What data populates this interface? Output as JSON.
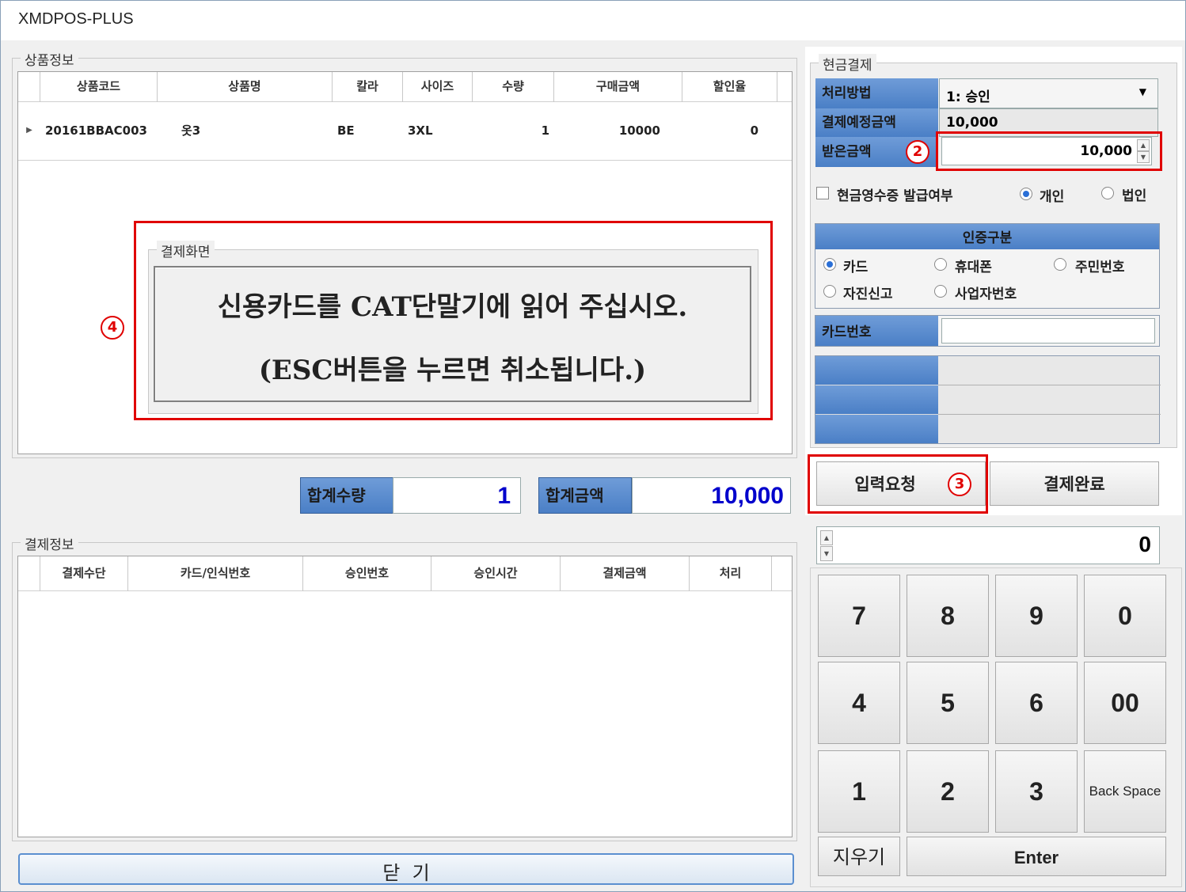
{
  "window": {
    "title": "XMDPOS-PLUS"
  },
  "product_group": {
    "legend": "상품정보",
    "columns": [
      "상품코드",
      "상품명",
      "칼라",
      "사이즈",
      "수량",
      "구매금액",
      "할인율"
    ],
    "rows": [
      {
        "code": "20161BBAC003",
        "name": "옷3",
        "color": "BE",
        "size": "3XL",
        "qty": "1",
        "amount": "10000",
        "discount": "0"
      }
    ]
  },
  "payment_screen": {
    "legend": "결제화면",
    "line1": "신용카드를 CAT단말기에 읽어 주십시오.",
    "line2": "(ESC버튼을 누르면 취소됩니다.)"
  },
  "totals": {
    "qty_label": "합계수량",
    "qty_value": "1",
    "amount_label": "합계금액",
    "amount_value": "10,000"
  },
  "payment_info": {
    "legend": "결제정보",
    "columns": [
      "결제수단",
      "카드/인식번호",
      "승인번호",
      "승인시간",
      "결제금액",
      "처리"
    ]
  },
  "close_button": "닫  기",
  "cash_panel": {
    "legend": "현금결제",
    "method_label": "처리방법",
    "method_value": "1: 승인",
    "due_label": "결제예정금액",
    "due_value": "10,000",
    "received_label": "받은금액",
    "received_value": "10,000",
    "receipt_label": "현금영수증 발급여부",
    "receipt_options": [
      "개인",
      "법인"
    ],
    "auth_header": "인증구분",
    "auth_options": [
      "카드",
      "휴대폰",
      "주민번호",
      "자진신고",
      "사업자번호"
    ],
    "card_label": "카드번호",
    "card_value": "",
    "request_button": "입력요청",
    "complete_button": "결제완료"
  },
  "keypad": {
    "display": "0",
    "keys": [
      "7",
      "8",
      "9",
      "0",
      "4",
      "5",
      "6",
      "00",
      "1",
      "2",
      "3",
      "Back Space"
    ],
    "clear": "지우기",
    "enter": "Enter"
  },
  "annotations": {
    "n2": "2",
    "n3": "3",
    "n4": "4"
  },
  "colors": {
    "accent_blue": "#4a7fc6",
    "highlight_red": "#e00000",
    "total_blue": "#0000cc"
  }
}
